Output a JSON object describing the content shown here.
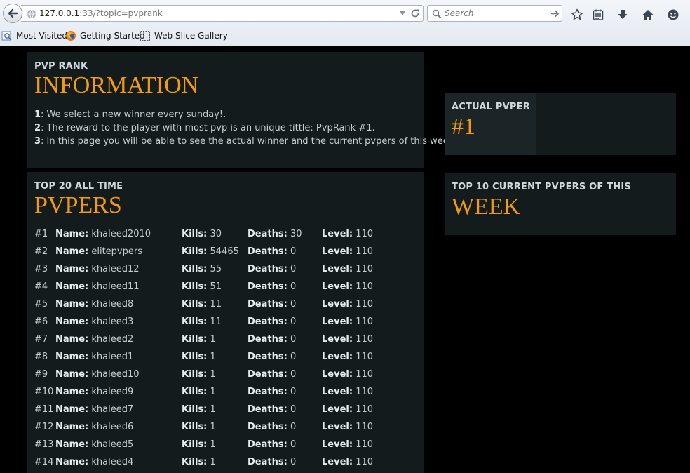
{
  "browser": {
    "url_host": "127.0.0.1",
    "url_rest": ":33/?topic=pvprank",
    "search_placeholder": "Search",
    "bookmarks": [
      {
        "label": "Most Visited"
      },
      {
        "label": "Getting Started"
      },
      {
        "label": "Web Slice Gallery"
      }
    ]
  },
  "info": {
    "kicker": "PVP RANK",
    "title": "INFORMATION",
    "lines": [
      {
        "num": "1",
        "text": ": We select a new winner every sunday!."
      },
      {
        "num": "2",
        "text": ": The reward to the player with most pvp is an unique tittle: PvpRank #1."
      },
      {
        "num": "3",
        "text": ": In this page you will be able to see the actual winner and the current pvpers of this week."
      }
    ]
  },
  "actual": {
    "kicker": "ACTUAL PVPER",
    "title": "#1"
  },
  "week": {
    "kicker": "TOP 10 CURRENT PVPERS OF THIS",
    "title": "WEEK"
  },
  "top": {
    "kicker": "TOP 20 ALL TIME",
    "title": "PVPERS",
    "labels": {
      "name": "Name:",
      "kills": "Kills:",
      "deaths": "Deaths:",
      "level": "Level:"
    },
    "rows": [
      {
        "rank": "#1",
        "name": "khaleed2010",
        "kills": "30",
        "deaths": "30",
        "level": "110"
      },
      {
        "rank": "#2",
        "name": "elitepvpers",
        "kills": "54465",
        "deaths": "0",
        "level": "110"
      },
      {
        "rank": "#3",
        "name": "khaleed12",
        "kills": "55",
        "deaths": "0",
        "level": "110"
      },
      {
        "rank": "#4",
        "name": "khaleed11",
        "kills": "51",
        "deaths": "0",
        "level": "110"
      },
      {
        "rank": "#5",
        "name": "khaleed8",
        "kills": "11",
        "deaths": "0",
        "level": "110"
      },
      {
        "rank": "#6",
        "name": "khaleed3",
        "kills": "11",
        "deaths": "0",
        "level": "110"
      },
      {
        "rank": "#7",
        "name": "khaleed2",
        "kills": "1",
        "deaths": "0",
        "level": "110"
      },
      {
        "rank": "#8",
        "name": "khaleed1",
        "kills": "1",
        "deaths": "0",
        "level": "110"
      },
      {
        "rank": "#9",
        "name": "khaleed10",
        "kills": "1",
        "deaths": "0",
        "level": "110"
      },
      {
        "rank": "#10",
        "name": "khaleed9",
        "kills": "1",
        "deaths": "0",
        "level": "110"
      },
      {
        "rank": "#11",
        "name": "khaleed7",
        "kills": "1",
        "deaths": "0",
        "level": "110"
      },
      {
        "rank": "#12",
        "name": "khaleed6",
        "kills": "1",
        "deaths": "0",
        "level": "110"
      },
      {
        "rank": "#13",
        "name": "khaleed5",
        "kills": "1",
        "deaths": "0",
        "level": "110"
      },
      {
        "rank": "#14",
        "name": "khaleed4",
        "kills": "1",
        "deaths": "0",
        "level": "110"
      }
    ]
  },
  "colors": {
    "accent": "#f39a0d",
    "panel": "#141b1d",
    "page_bg": "#000000"
  }
}
